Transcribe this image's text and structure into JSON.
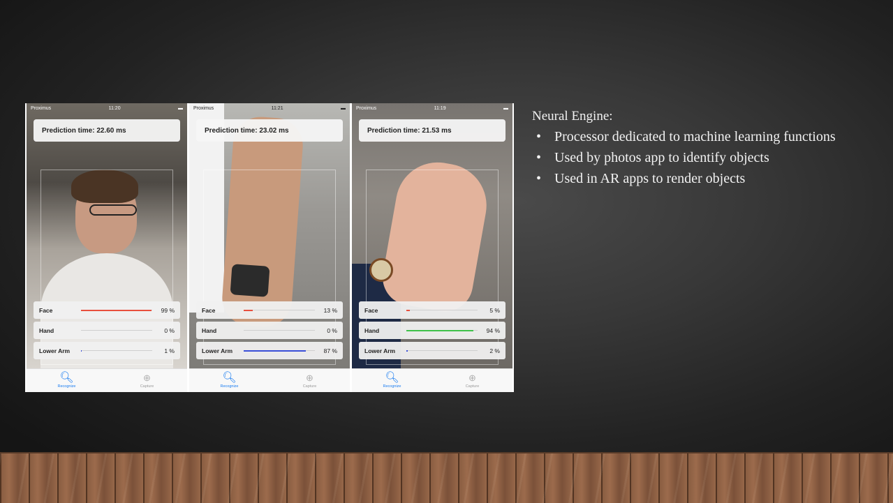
{
  "slide": {
    "heading": "Neural Engine:",
    "bullets": [
      "Processor dedicated to machine learning functions",
      "Used by photos app to identify objects",
      "Used in AR apps to render objects"
    ]
  },
  "phones": [
    {
      "status": {
        "carrier": "Proximus",
        "time": "11:20"
      },
      "prediction": "Prediction time: 22.60 ms",
      "bars": [
        {
          "label": "Face",
          "value": 99,
          "pct": "99 %",
          "color": "#e8503e"
        },
        {
          "label": "Hand",
          "value": 0,
          "pct": "0 %",
          "color": "#3fc24a"
        },
        {
          "label": "Lower Arm",
          "value": 1,
          "pct": "1 %",
          "color": "#3a4fd8"
        }
      ],
      "tabs": {
        "recognize": "Recognize",
        "capture": "Capture"
      }
    },
    {
      "status": {
        "carrier": "Proximus",
        "time": "11:21"
      },
      "prediction": "Prediction time: 23.02 ms",
      "bars": [
        {
          "label": "Face",
          "value": 13,
          "pct": "13 %",
          "color": "#e8503e"
        },
        {
          "label": "Hand",
          "value": 0,
          "pct": "0 %",
          "color": "#3fc24a"
        },
        {
          "label": "Lower Arm",
          "value": 87,
          "pct": "87 %",
          "color": "#3a4fd8"
        }
      ],
      "tabs": {
        "recognize": "Recognize",
        "capture": "Capture"
      }
    },
    {
      "status": {
        "carrier": "Proximus",
        "time": "11:19"
      },
      "prediction": "Prediction time: 21.53 ms",
      "bars": [
        {
          "label": "Face",
          "value": 5,
          "pct": "5 %",
          "color": "#e8503e"
        },
        {
          "label": "Hand",
          "value": 94,
          "pct": "94 %",
          "color": "#3fc24a"
        },
        {
          "label": "Lower Arm",
          "value": 2,
          "pct": "2 %",
          "color": "#3a4fd8"
        }
      ],
      "tabs": {
        "recognize": "Recognize",
        "capture": "Capture"
      }
    }
  ]
}
